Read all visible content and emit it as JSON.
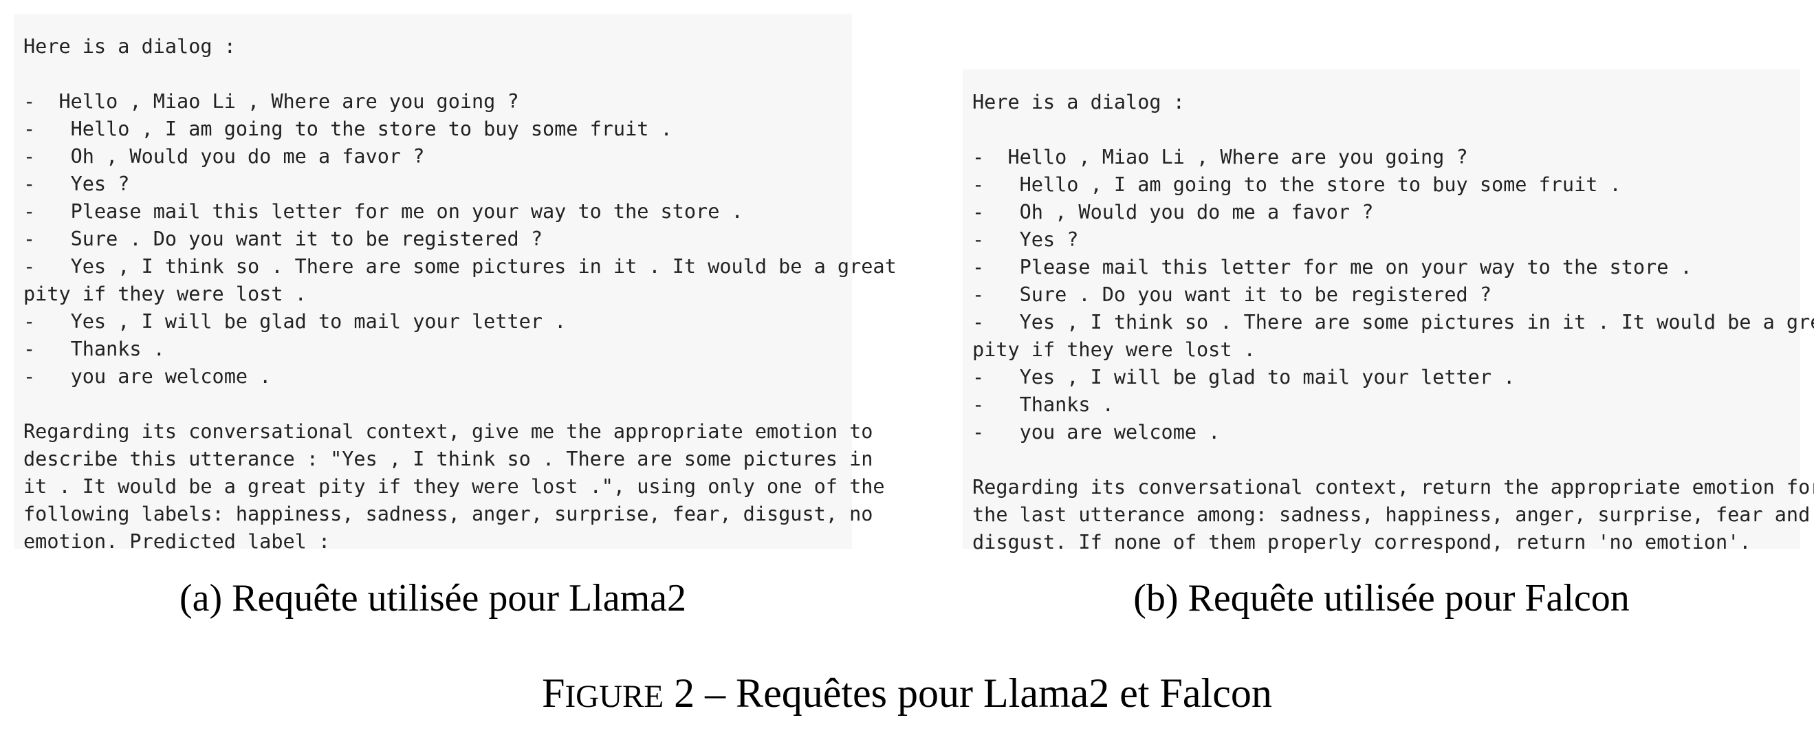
{
  "panel_a": {
    "lines": [
      "Here is a dialog :",
      "",
      "-  Hello , Miao Li , Where are you going ?",
      "-   Hello , I am going to the store to buy some fruit .",
      "-   Oh , Would you do me a favor ?",
      "-   Yes ?",
      "-   Please mail this letter for me on your way to the store .",
      "-   Sure . Do you want it to be registered ?",
      "-   Yes , I think so . There are some pictures in it . It would be a great",
      "pity if they were lost .",
      "-   Yes , I will be glad to mail your letter .",
      "-   Thanks .",
      "-   you are welcome .",
      "",
      "Regarding its conversational context, give me the appropriate emotion to",
      "describe this utterance : \"Yes , I think so . There are some pictures in",
      "it . It would be a great pity if they were lost .\", using only one of the",
      "following labels: happiness, sadness, anger, surprise, fear, disgust, no",
      "emotion. Predicted label :"
    ],
    "caption": "(a) Requête utilisée pour Llama2"
  },
  "panel_b": {
    "lines": [
      "Here is a dialog :",
      "",
      "-  Hello , Miao Li , Where are you going ?",
      "-   Hello , I am going to the store to buy some fruit .",
      "-   Oh , Would you do me a favor ?",
      "-   Yes ?",
      "-   Please mail this letter for me on your way to the store .",
      "-   Sure . Do you want it to be registered ?",
      "-   Yes , I think so . There are some pictures in it . It would be a great",
      "pity if they were lost .",
      "-   Yes , I will be glad to mail your letter .",
      "-   Thanks .",
      "-   you are welcome .",
      "",
      "Regarding its conversational context, return the appropriate emotion for",
      "the last utterance among: sadness, happiness, anger, surprise, fear and",
      "disgust. If none of them properly correspond, return 'no emotion'."
    ],
    "caption": "(b) Requête utilisée pour Falcon"
  },
  "figure_caption": {
    "label_first": "F",
    "label_rest": "IGURE",
    "number": "2",
    "separator": "–",
    "text": "Requêtes pour Llama2 et Falcon"
  }
}
